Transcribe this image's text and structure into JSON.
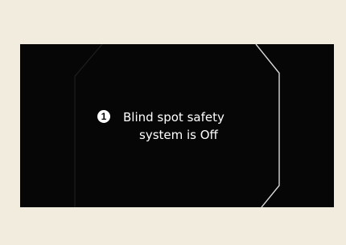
{
  "warning": {
    "number": "1",
    "line1": "Blind spot safety",
    "line2": "system is Off"
  },
  "colors": {
    "background": "#f1ecde",
    "display": "#060606",
    "text": "#ffffff"
  }
}
